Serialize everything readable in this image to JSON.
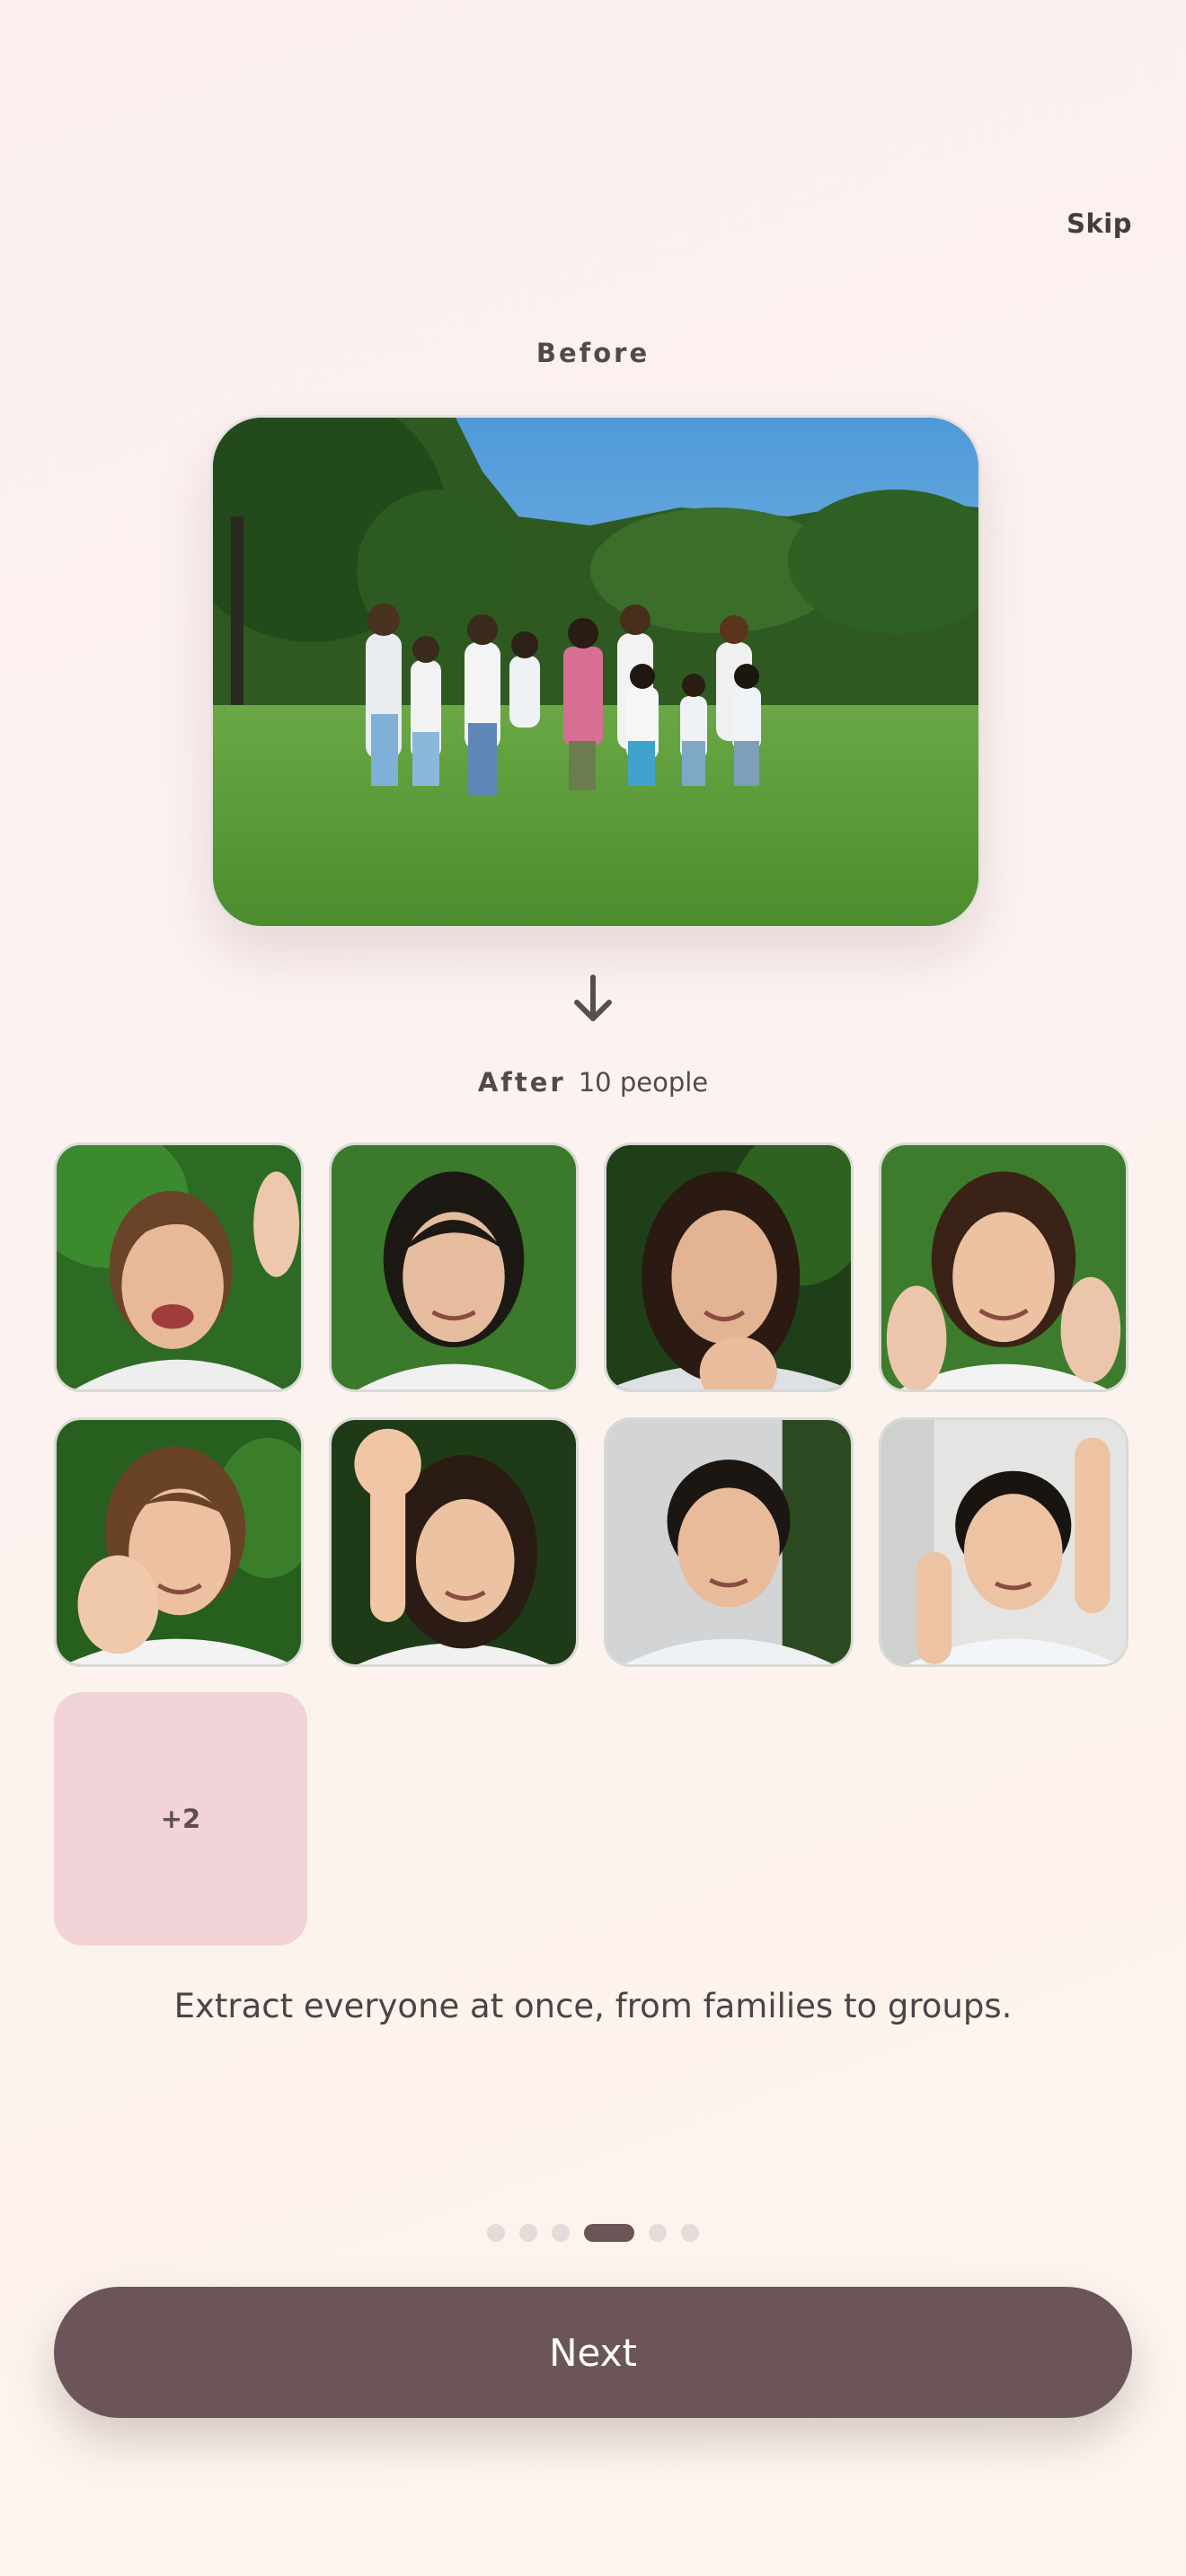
{
  "header": {
    "skip_label": "Skip"
  },
  "before": {
    "label": "Before"
  },
  "after": {
    "label": "After",
    "count_label": "10 people"
  },
  "faces": [
    {
      "name": "face-1"
    },
    {
      "name": "face-2"
    },
    {
      "name": "face-3"
    },
    {
      "name": "face-4"
    },
    {
      "name": "face-5"
    },
    {
      "name": "face-6"
    },
    {
      "name": "face-7"
    },
    {
      "name": "face-8"
    }
  ],
  "more": {
    "label": "+2"
  },
  "caption": "Extract everyone at once, from families to groups.",
  "pagination": {
    "total": 6,
    "active": 3
  },
  "next": {
    "label": "Next"
  },
  "colors": {
    "accent": "#6b5558",
    "more_tile": "#f2d3d7"
  }
}
